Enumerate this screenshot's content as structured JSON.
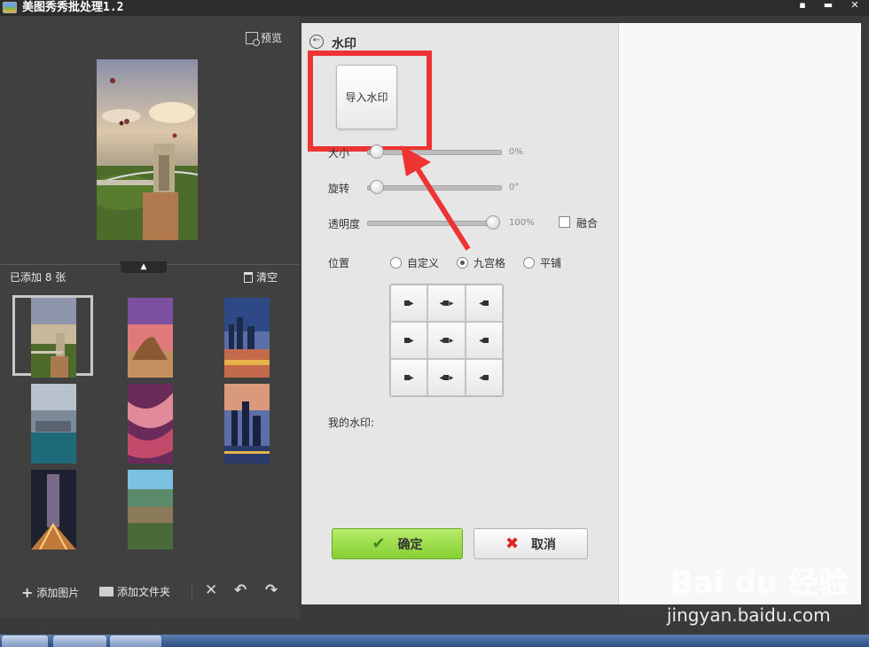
{
  "window": {
    "title": "美图秀秀批处理1.2"
  },
  "left_panel": {
    "preview_label": "预览",
    "added_count": "已添加 8 张",
    "clear_label": "清空",
    "collapse_symbol": "▲",
    "bottom_bar": {
      "add_image_label": "添加图片",
      "add_folder_label": "添加文件夹",
      "delete_symbol": "✕",
      "rotate_left_symbol": "↶",
      "rotate_right_symbol": "↷"
    },
    "thumbnails": [
      {
        "name": "bridge-balloons",
        "selected": true
      },
      {
        "name": "sphinx-sunset",
        "selected": false
      },
      {
        "name": "city-night-pier",
        "selected": false
      },
      {
        "name": "harbor-aerial",
        "selected": false
      },
      {
        "name": "antelope-canyon",
        "selected": false
      },
      {
        "name": "skyline-dusk",
        "selected": false
      },
      {
        "name": "tower-light-trails",
        "selected": false
      },
      {
        "name": "mountain-valley",
        "selected": false
      }
    ]
  },
  "watermark_panel": {
    "title": "水印",
    "import_button": "导入水印",
    "size_label": "大小",
    "size_value": "0%",
    "size_level": 0,
    "rotate_label": "旋转",
    "rotate_value": "0°",
    "rotate_level": 0,
    "opacity_label": "透明度",
    "opacity_value": "100%",
    "opacity_level": 1,
    "merge_label": "融合",
    "merge_checked": false,
    "position_label": "位置",
    "position_options": [
      {
        "label": "自定义",
        "selected": false
      },
      {
        "label": "九宫格",
        "selected": true
      },
      {
        "label": "平铺",
        "selected": false
      }
    ],
    "my_watermark_label": "我的水印:",
    "ok_button": "确定",
    "cancel_button": "取消"
  },
  "site_watermark": {
    "logo": "Bai du 经验",
    "url": "jingyan.baidu.com"
  },
  "colors": {
    "highlight": "#ee3333",
    "ok_green": "#86cf34",
    "cancel_red": "#e02424",
    "dark_panel": "#404040",
    "light_panel": "#e6e6e6"
  }
}
